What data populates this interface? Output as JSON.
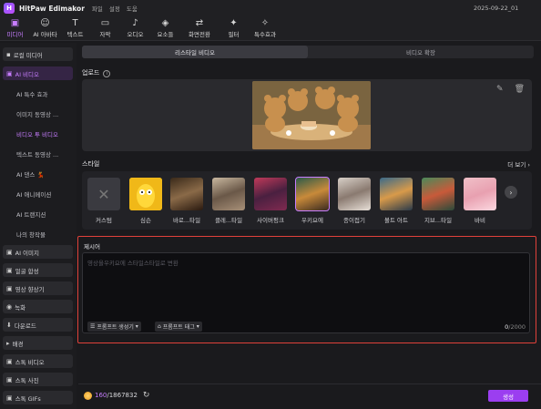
{
  "app": {
    "title": "HitPaw Edimakor",
    "menu": [
      "파일",
      "설정",
      "도움"
    ],
    "date": "2025-09-22_01"
  },
  "toolbar": [
    {
      "label": "미디어",
      "icon": "folder-icon",
      "glyph": "▣",
      "active": true
    },
    {
      "label": "AI 아바타",
      "icon": "avatar-icon",
      "glyph": "☺"
    },
    {
      "label": "텍스트",
      "icon": "text-icon",
      "glyph": "T"
    },
    {
      "label": "자막",
      "icon": "subtitle-icon",
      "glyph": "▭"
    },
    {
      "label": "오디오",
      "icon": "audio-icon",
      "glyph": "♪"
    },
    {
      "label": "요소들",
      "icon": "elements-icon",
      "glyph": "◈"
    },
    {
      "label": "화면전환",
      "icon": "transition-icon",
      "glyph": "⇄"
    },
    {
      "label": "필터",
      "icon": "filter-icon",
      "glyph": "✦"
    },
    {
      "label": "특수효과",
      "icon": "effects-icon",
      "glyph": "✧"
    }
  ],
  "sidebar": {
    "local_media": "로컬 미디어",
    "ai_video": "AI 비디오",
    "sub_items": [
      "AI 특수 효과",
      "이미지 동영상 ...",
      "비디오 투 비디오",
      "텍스트 동영상 ...",
      "AI 댄스 💃",
      "AI 애니메이션",
      "AI 트랜지션",
      "나의 창작물"
    ],
    "sections": [
      "AI 이미지",
      "얼굴 합성",
      "영상 향상기",
      "녹화",
      "다운로드",
      "배경",
      "스톡 비디오",
      "스톡 사진",
      "스톡 GIFs"
    ]
  },
  "main": {
    "tabs": [
      "리스타일 비디오",
      "비디오 확장"
    ],
    "upload_label": "업로드",
    "style_label": "스타일",
    "see_more": "더 보기",
    "styles": [
      {
        "name": "커스텀"
      },
      {
        "name": "심슨"
      },
      {
        "name": "바로...타일"
      },
      {
        "name": "클레...타일"
      },
      {
        "name": "사이버펑크"
      },
      {
        "name": "우키요에"
      },
      {
        "name": "종이접기"
      },
      {
        "name": "볼트 아트"
      },
      {
        "name": "지브...타일"
      },
      {
        "name": "바비"
      }
    ],
    "prompt_label": "제시어",
    "prompt_placeholder": "영상을우키요에 스타일스타일로 변환",
    "prompt_gen_chip": "프롬프트 생성기",
    "prompt_tag_chip": "프롬프트 태그",
    "counter_cur": "0",
    "counter_max": "/2000"
  },
  "bottom": {
    "credits_used": "160",
    "credits_total": "/1867832",
    "generate": "생성"
  },
  "colors": {
    "accent": "#c77dff",
    "button": "#9b3ef0",
    "highlight": "#e0413a"
  }
}
